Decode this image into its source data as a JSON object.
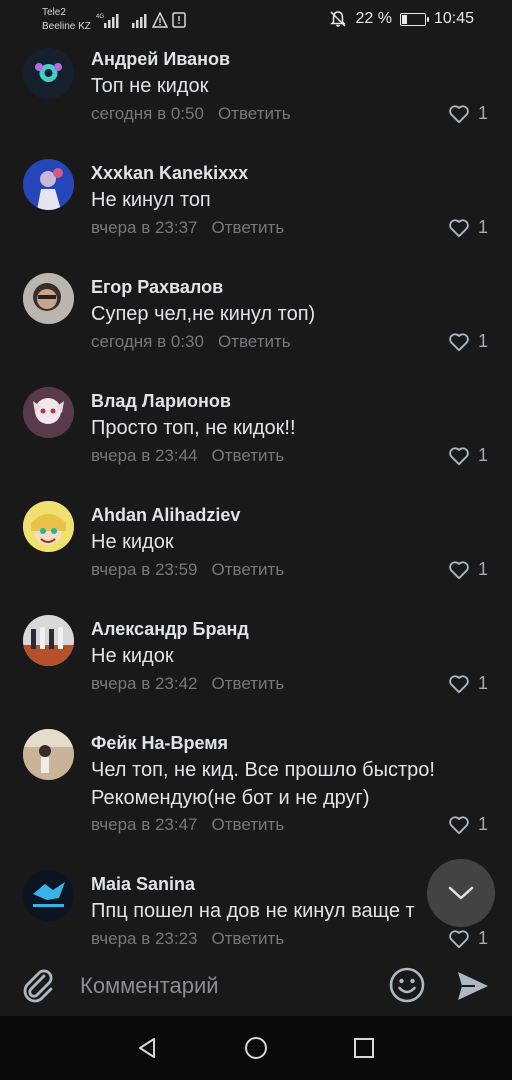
{
  "status_bar": {
    "carrier1": "Tele2",
    "carrier2": "Beeline KZ",
    "network": "4G",
    "battery_percent": "22 %",
    "battery_level": 0.22,
    "time": "10:45"
  },
  "comments": [
    {
      "author": "Андрей Иванов",
      "text": "Топ не кидок",
      "time": "сегодня в 0:50",
      "reply": "Ответить",
      "likes": "1"
    },
    {
      "author": "Xxxkan Kanekixxx",
      "text": "Не кинул топ",
      "time": "вчера в 23:37",
      "reply": "Ответить",
      "likes": "1"
    },
    {
      "author": "Егор Рахвалов",
      "text": "Супер чел,не кинул топ)",
      "time": "сегодня в 0:30",
      "reply": "Ответить",
      "likes": "1"
    },
    {
      "author": "Влад Ларионов",
      "text": "Просто топ, не кидок!!",
      "time": "вчера в 23:44",
      "reply": "Ответить",
      "likes": "1"
    },
    {
      "author": "Ahdan Alihadziev",
      "text": "Не кидок",
      "time": "вчера в 23:59",
      "reply": "Ответить",
      "likes": "1"
    },
    {
      "author": "Александр Бранд",
      "text": "Не кидок",
      "time": "вчера в 23:42",
      "reply": "Ответить",
      "likes": "1"
    },
    {
      "author": "Фейк На-Время",
      "text": "Чел топ, не кид. Все прошло быстро! Рекомендую(не бот и не друг)",
      "time": "вчера в 23:47",
      "reply": "Ответить",
      "likes": "1"
    },
    {
      "author": "Maia Sanina",
      "text": "Ппц пошел на дов не кинул ваще т",
      "time": "вчера в 23:23",
      "reply": "Ответить",
      "likes": "1"
    }
  ],
  "input": {
    "placeholder": "Комментарий"
  },
  "icons": {
    "attach": "paperclip-icon",
    "emoji": "smiley-icon",
    "send": "send-icon",
    "scroll_down": "chevron-down-icon",
    "like": "heart-icon"
  },
  "colors": {
    "background": "#19191a",
    "text": "#e1e3e6",
    "secondary": "#76787a",
    "icon": "#aeb7c2"
  }
}
